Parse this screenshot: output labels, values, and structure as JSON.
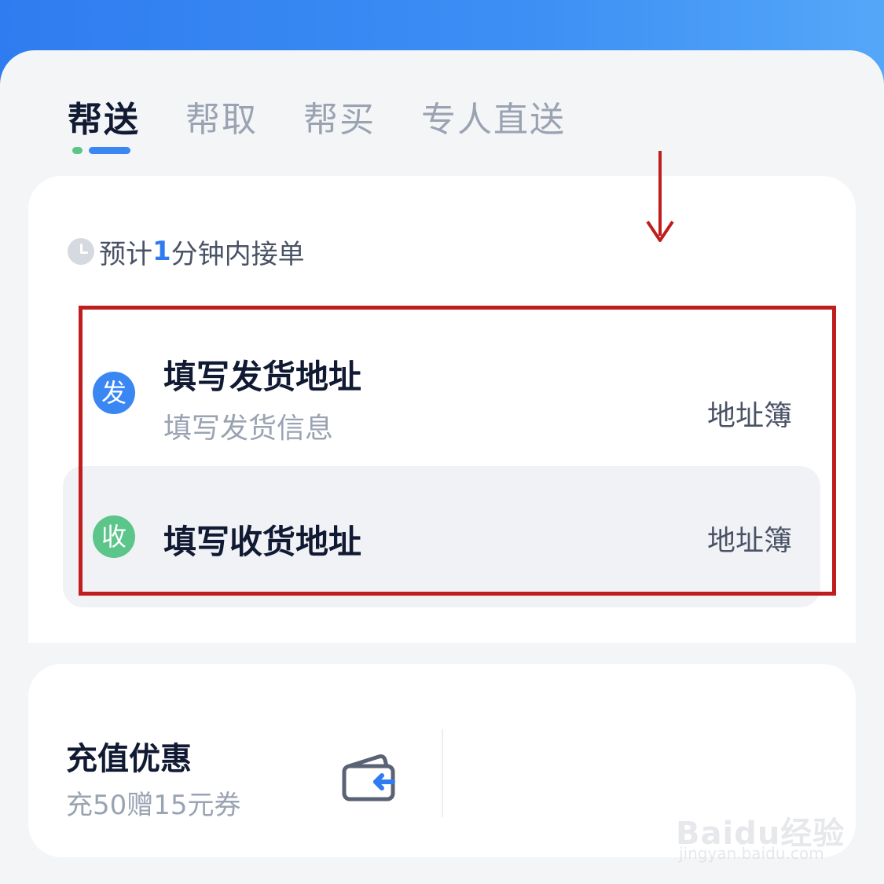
{
  "tabs": [
    {
      "label": "帮送",
      "active": true
    },
    {
      "label": "帮取",
      "active": false
    },
    {
      "label": "帮买",
      "active": false
    },
    {
      "label": "专人直送",
      "active": false
    }
  ],
  "eta": {
    "prefix": "预计",
    "minutes": "1",
    "suffix": "分钟内接单",
    "icon": "clock-icon"
  },
  "send": {
    "badge": "发",
    "title": "填写发货地址",
    "subtitle": "填写发货信息",
    "address_book": "地址簿"
  },
  "receive": {
    "badge": "收",
    "title": "填写收货地址",
    "address_book": "地址簿"
  },
  "promo": {
    "title": "充值优惠",
    "subtitle": "充50赠15元券",
    "icon": "wallet-icon"
  },
  "watermark": {
    "logo": "Baidu经验",
    "url": "jingyan.baidu.com"
  },
  "colors": {
    "accent": "#2f7cf0",
    "send": "#3a86f3",
    "receive": "#5cc58a",
    "annotation": "#c01d1d"
  }
}
